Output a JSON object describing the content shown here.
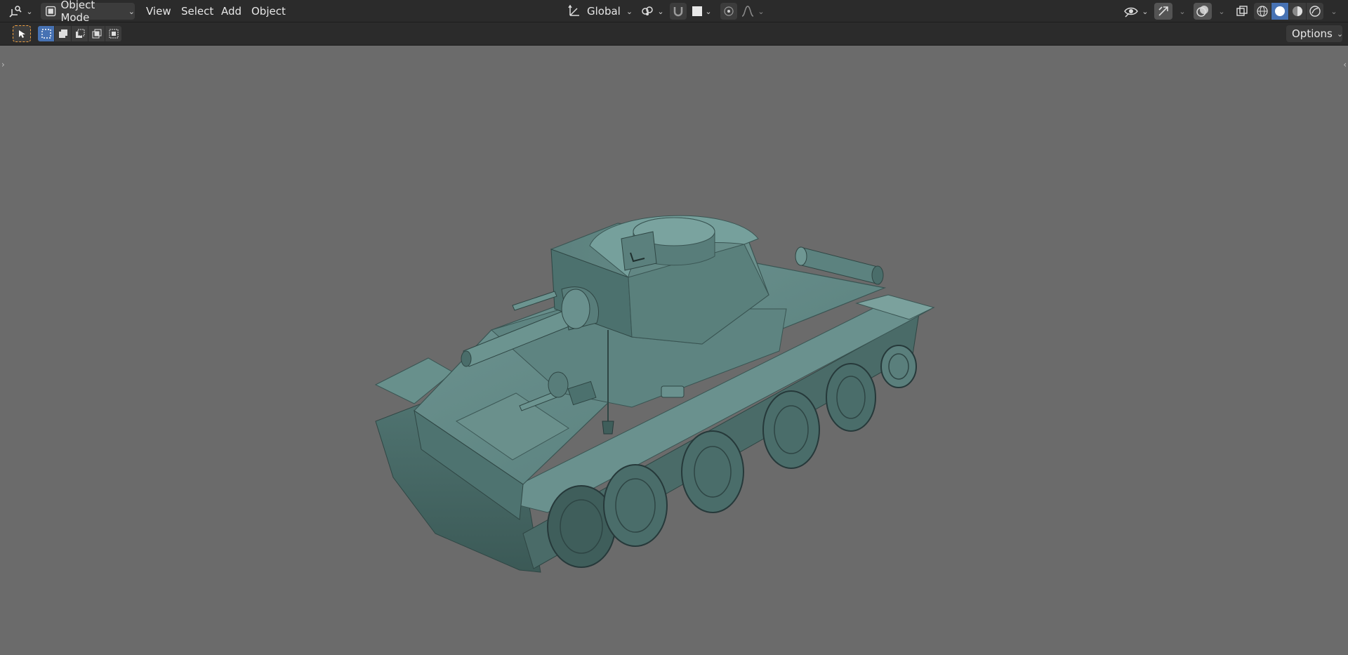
{
  "header": {
    "editor_type_icon": "editor-type-3d-viewport-icon",
    "mode": {
      "label": "Object Mode",
      "icon": "object-mode-icon"
    },
    "menus": [
      "View",
      "Select",
      "Add",
      "Object"
    ],
    "transform_orientation": {
      "label": "Global",
      "icon": "transform-orientation-icon"
    },
    "pivot_icon": "pivot-point-icon",
    "snap_icon": "snap-magnet-icon",
    "proportional_icon": "proportional-editing-icon",
    "falloff_icon": "falloff-curve-icon",
    "visibility_icon": "eye-visibility-icon",
    "gizmo_icon": "gizmo-icon",
    "overlay_icon": "overlays-icon",
    "xray_icon": "xray-toggle-icon",
    "shading_modes": [
      "wireframe",
      "solid",
      "material-preview",
      "rendered"
    ],
    "active_shading": "solid"
  },
  "toolbar": {
    "select_tool_icon": "select-box-tool-icon",
    "selection_modes": [
      "set-new",
      "extend",
      "subtract",
      "intersect",
      "invert"
    ],
    "options_label": "Options"
  },
  "viewport": {
    "background": "#6b6b6b",
    "model_color": "#5b807d",
    "object": "tank-3d-model"
  },
  "colors": {
    "header_bg": "#2b2b2b",
    "accent": "#4772b3",
    "select_orange": "#f0a040"
  }
}
